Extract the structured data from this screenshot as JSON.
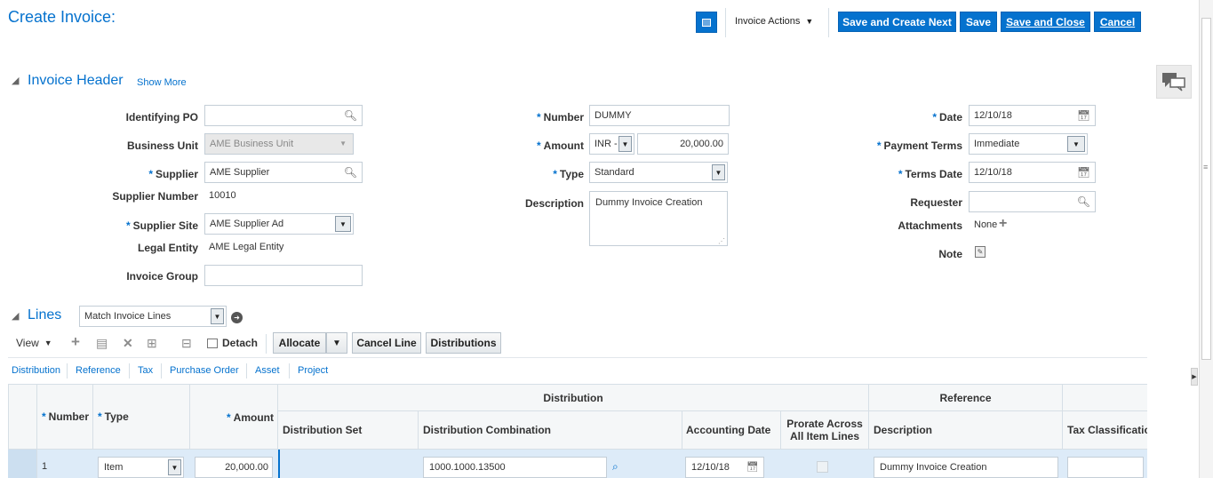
{
  "page": {
    "title": "Create Invoice:"
  },
  "header_actions": {
    "invoice_actions": "Invoice Actions",
    "save_and_create_next": "Save and Create Next",
    "save": "Save",
    "save_and_close": "Save and Close",
    "cancel": "Cancel"
  },
  "invoice_header": {
    "title": "Invoice Header",
    "show_more": "Show More",
    "identifying_po": {
      "label": "Identifying PO",
      "value": ""
    },
    "business_unit": {
      "label": "Business Unit",
      "value": "AME Business Unit"
    },
    "supplier": {
      "label": "Supplier",
      "value": "AME Supplier"
    },
    "supplier_number": {
      "label": "Supplier Number",
      "value": "10010"
    },
    "supplier_site": {
      "label": "Supplier Site",
      "value": "AME Supplier Ad"
    },
    "legal_entity": {
      "label": "Legal Entity",
      "value": "AME Legal Entity"
    },
    "invoice_group": {
      "label": "Invoice Group",
      "value": ""
    },
    "number": {
      "label": "Number",
      "value": "DUMMY"
    },
    "amount": {
      "label": "Amount",
      "currency": "INR -",
      "value": "20,000.00"
    },
    "type": {
      "label": "Type",
      "value": "Standard"
    },
    "description": {
      "label": "Description",
      "value": "Dummy Invoice Creation"
    },
    "date": {
      "label": "Date",
      "value": "12/10/18"
    },
    "payment_terms": {
      "label": "Payment Terms",
      "value": "Immediate"
    },
    "terms_date": {
      "label": "Terms Date",
      "value": "12/10/18"
    },
    "requester": {
      "label": "Requester",
      "value": ""
    },
    "attachments": {
      "label": "Attachments",
      "value": "None"
    },
    "note": {
      "label": "Note"
    }
  },
  "lines": {
    "title": "Lines",
    "match_select": "Match Invoice Lines",
    "view": "View",
    "detach": "Detach",
    "allocate": "Allocate",
    "cancel_line": "Cancel Line",
    "distributions": "Distributions",
    "subtabs": [
      "Distribution",
      "Reference",
      "Tax",
      "Purchase Order",
      "Asset",
      "Project"
    ],
    "group_headers": {
      "distribution": "Distribution",
      "reference": "Reference"
    },
    "columns": {
      "number": "Number",
      "type": "Type",
      "amount": "Amount",
      "distribution_set": "Distribution Set",
      "distribution_combination": "Distribution Combination",
      "accounting_date": "Accounting Date",
      "prorate_line1": "Prorate Across",
      "prorate_line2": "All Item Lines",
      "description": "Description",
      "tax_classification": "Tax Classificatio"
    },
    "rows": [
      {
        "number": "1",
        "type": "Item",
        "amount": "20,000.00",
        "distribution_set": "",
        "distribution_combination": "1000.1000.13500",
        "accounting_date": "12/10/18",
        "description": "Dummy Invoice Creation",
        "tax_classification": ""
      }
    ]
  },
  "colors": {
    "accent": "#0572ce",
    "selected_row": "#ddebf8"
  }
}
